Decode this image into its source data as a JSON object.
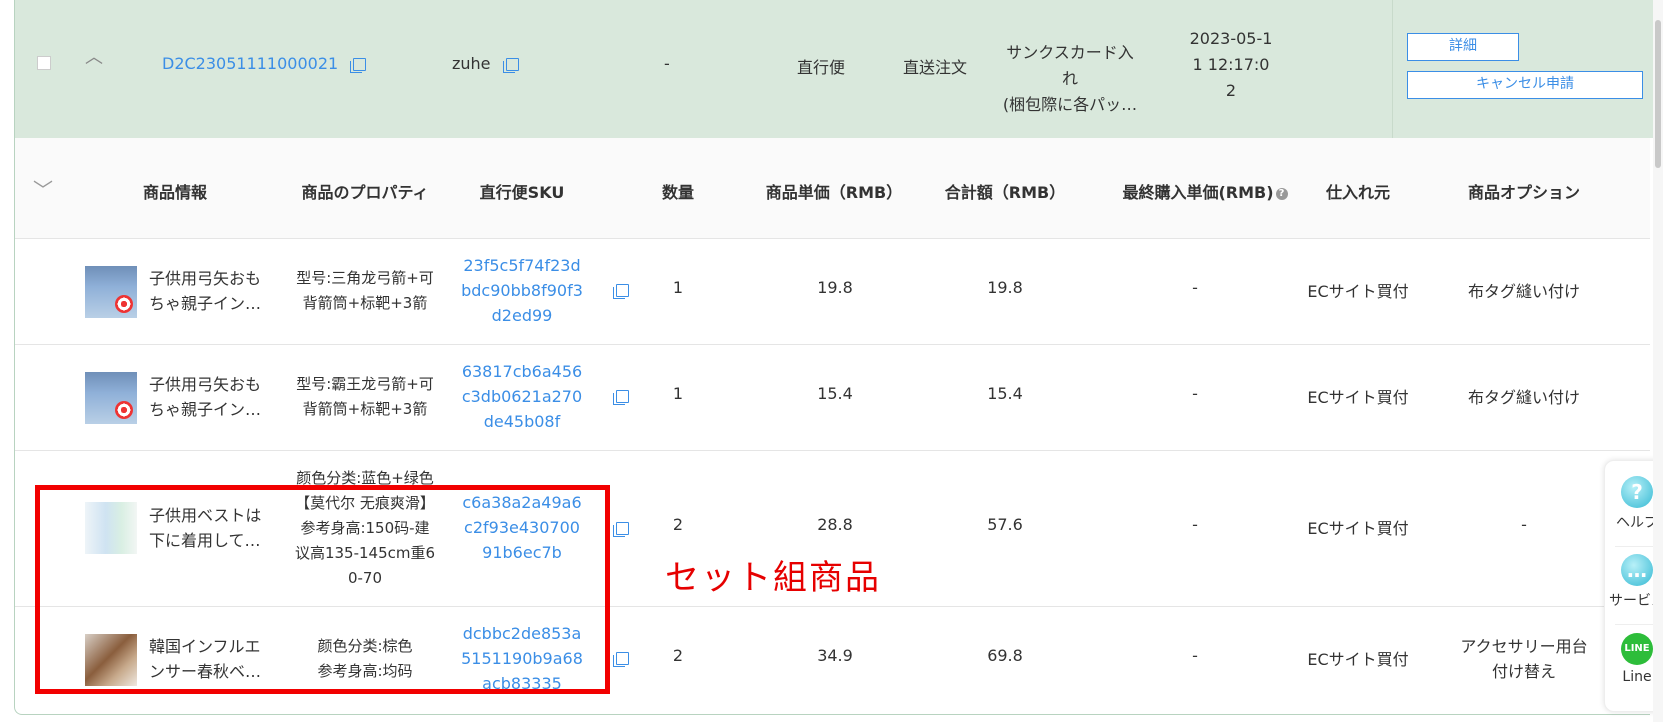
{
  "order": {
    "id": "D2C23051111000021",
    "user": "zuhe",
    "col3": "-",
    "shipping": "直行便",
    "order_type": "直送注文",
    "thanks_line1": "サンクスカード入れ",
    "thanks_line2": "(梱包際に各パッ…",
    "date_line1": "2023-05-1",
    "date_line2": "1 12:17:0",
    "date_line3": "2",
    "btn_detail": "詳細",
    "btn_cancel": "キャンセル申請"
  },
  "table": {
    "headers": {
      "product_info": "商品情報",
      "properties": "商品のプロパティ",
      "sku": "直行便SKU",
      "qty": "数量",
      "unit_price": "商品単価（RMB）",
      "total": "合計額（RMB）",
      "last_price": "最終購入単価(RMB)",
      "supplier": "仕入れ元",
      "options": "商品オプション"
    },
    "rows": [
      {
        "name_l1": "子供用弓矢おも",
        "name_l2": "ちゃ親子イン…",
        "prop_l1": "型号:三角龙弓箭+可",
        "prop_l2": "背箭筒+标靶+3箭",
        "prop_l3": "",
        "prop_l4": "",
        "prop_l5": "",
        "sku_l1": "23f5c5f74f23d",
        "sku_l2": "bdc90bb8f90f3",
        "sku_l3": "d2ed99",
        "qty": "1",
        "unit_price": "19.8",
        "total": "19.8",
        "last_price": "-",
        "supplier": "ECサイト買付",
        "option_l1": "布タグ縫い付け",
        "option_l2": ""
      },
      {
        "name_l1": "子供用弓矢おも",
        "name_l2": "ちゃ親子イン…",
        "prop_l1": "型号:霸王龙弓箭+可",
        "prop_l2": "背箭筒+标靶+3箭",
        "prop_l3": "",
        "prop_l4": "",
        "prop_l5": "",
        "sku_l1": "63817cb6a456",
        "sku_l2": "c3db0621a270",
        "sku_l3": "de45b08f",
        "qty": "1",
        "unit_price": "15.4",
        "total": "15.4",
        "last_price": "-",
        "supplier": "ECサイト買付",
        "option_l1": "布タグ縫い付け",
        "option_l2": ""
      },
      {
        "name_l1": "子供用ベストは",
        "name_l2": "下に着用して…",
        "prop_l1": "颜色分类:蓝色+绿色",
        "prop_l2": "【莫代尔 无痕爽滑】",
        "prop_l3": "参考身高:150码-建",
        "prop_l4": "议高135-145cm重6",
        "prop_l5": "0-70",
        "sku_l1": "c6a38a2a49a6",
        "sku_l2": "c2f93e430700",
        "sku_l3": "91b6ec7b",
        "qty": "2",
        "unit_price": "28.8",
        "total": "57.6",
        "last_price": "-",
        "supplier": "ECサイト買付",
        "option_l1": "-",
        "option_l2": ""
      },
      {
        "name_l1": "韓国インフルエ",
        "name_l2": "ンサー春秋ベ…",
        "prop_l1": "颜色分类:棕色",
        "prop_l2": "参考身高:均码",
        "prop_l3": "",
        "prop_l4": "",
        "prop_l5": "",
        "sku_l1": "dcbbc2de853a",
        "sku_l2": "5151190b9a68",
        "sku_l3": "acb83335",
        "qty": "2",
        "unit_price": "34.9",
        "total": "69.8",
        "last_price": "-",
        "supplier": "ECサイト買付",
        "option_l1": "アクセサリー用台",
        "option_l2": "付け替え"
      }
    ]
  },
  "annotation": {
    "label": "セット組商品",
    "color": "#f20000"
  },
  "float_widget": {
    "help": "ヘルプ",
    "service": "サービス",
    "line": "Line"
  },
  "colors": {
    "header_bg": "#d9e8dc",
    "link": "#3b8ee6"
  }
}
